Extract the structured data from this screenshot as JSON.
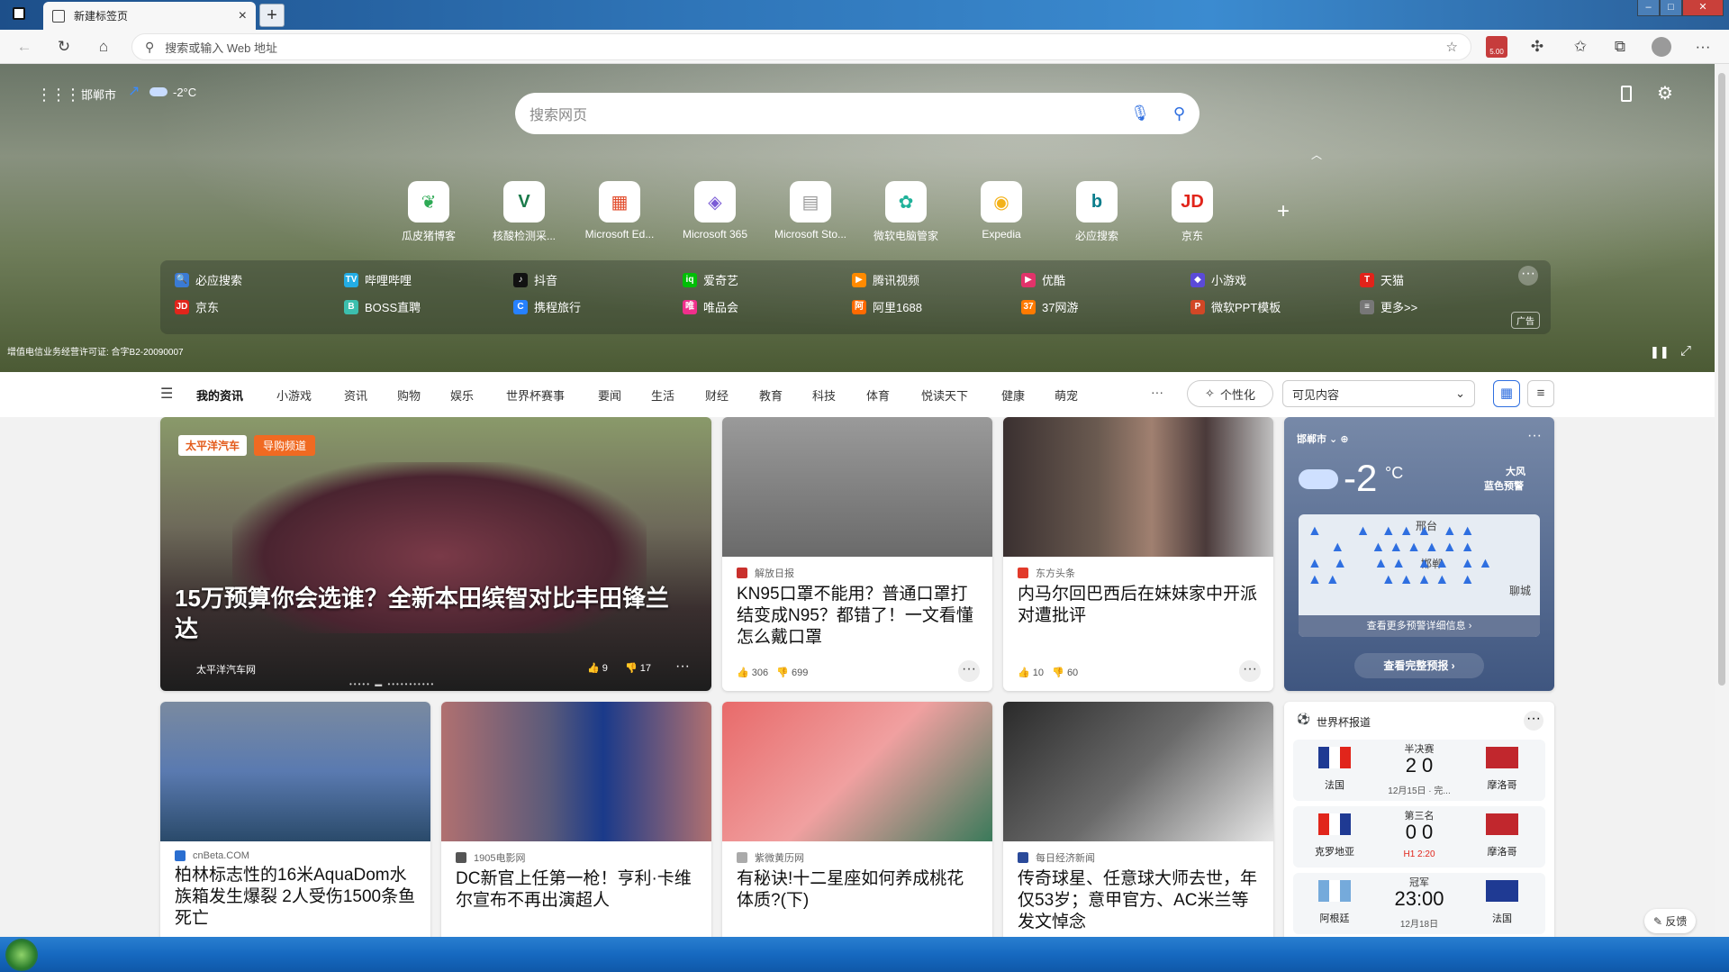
{
  "browser": {
    "tab_title": "新建标签页",
    "tab_close": "×",
    "new_tab": "+",
    "address_placeholder": "搜索或输入 Web 地址",
    "badge": "5.00",
    "win_min": "–",
    "win_max": "□",
    "win_close": "✕"
  },
  "header": {
    "city": "邯郸市",
    "temp": "-2°C",
    "search_placeholder": "搜索网页",
    "license": "增值电信业务经营许可证: 合字B2-20090007"
  },
  "quick_links": [
    {
      "label": "瓜皮猪博客",
      "glyph": "❦",
      "color": "#2eaa55"
    },
    {
      "label": "核酸检测采...",
      "glyph": "V",
      "color": "#1a7a4a"
    },
    {
      "label": "Microsoft Ed...",
      "glyph": "▦",
      "color": "#e24c2c"
    },
    {
      "label": "Microsoft 365",
      "glyph": "◈",
      "color": "#7b5cd6"
    },
    {
      "label": "Microsoft Sto...",
      "glyph": "▤",
      "color": "#999999"
    },
    {
      "label": "微软电脑管家",
      "glyph": "✿",
      "color": "#1fb29a"
    },
    {
      "label": "Expedia",
      "glyph": "◉",
      "color": "#f3b21a"
    },
    {
      "label": "必应搜索",
      "glyph": "b",
      "color": "#0a7d8c"
    },
    {
      "label": "京东",
      "glyph": "JD",
      "color": "#e1251b"
    }
  ],
  "site_links": [
    {
      "label": "必应搜索",
      "glyph": "🔍",
      "color": "#3a7bd5"
    },
    {
      "label": "哔哩哔哩",
      "glyph": "TV",
      "color": "#23ade5"
    },
    {
      "label": "抖音",
      "glyph": "♪",
      "color": "#111111"
    },
    {
      "label": "爱奇艺",
      "glyph": "iq",
      "color": "#00be06"
    },
    {
      "label": "腾讯视频",
      "glyph": "▶",
      "color": "#ff8a00"
    },
    {
      "label": "优酷",
      "glyph": "▶",
      "color": "#e2336a"
    },
    {
      "label": "小游戏",
      "glyph": "◆",
      "color": "#5b4ad8"
    },
    {
      "label": "天猫",
      "glyph": "T",
      "color": "#e2231a"
    },
    {
      "label": "京东",
      "glyph": "JD",
      "color": "#e1251b"
    },
    {
      "label": "BOSS直聘",
      "glyph": "B",
      "color": "#3cbfae"
    },
    {
      "label": "携程旅行",
      "glyph": "C",
      "color": "#2681ff"
    },
    {
      "label": "唯品会",
      "glyph": "唯",
      "color": "#f02f8c"
    },
    {
      "label": "阿里1688",
      "glyph": "阿",
      "color": "#ff6a00"
    },
    {
      "label": "37网游",
      "glyph": "37",
      "color": "#ff7a00"
    },
    {
      "label": "微软PPT模板",
      "glyph": "P",
      "color": "#d24726"
    },
    {
      "label": "更多>>",
      "glyph": "≡",
      "color": "#777777"
    }
  ],
  "ad_label": "广告",
  "nav": {
    "items": [
      "我的资讯",
      "小游戏",
      "资讯",
      "购物",
      "娱乐",
      "世界杯赛事",
      "要闻",
      "生活",
      "财经",
      "教育",
      "科技",
      "体育",
      "悦读天下",
      "健康",
      "萌宠"
    ],
    "more": "···",
    "personalize": "个性化",
    "visible_content": "可见内容"
  },
  "cards": [
    {
      "source": "太平洋汽车网",
      "title": "15万预算你会选谁？全新本田缤智对比丰田锋兰达",
      "likes": "9",
      "dislikes": "17",
      "tag1": "太平洋汽车",
      "tag2": "导购频道"
    },
    {
      "source": "解放日报",
      "title": "KN95口罩不能用？普通口罩打结变成N95？都错了！一文看懂怎么戴口罩",
      "likes": "306",
      "dislikes": "699"
    },
    {
      "source": "东方头条",
      "title": "内马尔回巴西后在妹妹家中开派对遭批评",
      "likes": "10",
      "dislikes": "60"
    },
    {
      "source": "cnBeta.COM",
      "title": "柏林标志性的16米AquaDom水族箱发生爆裂 2人受伤1500条鱼死亡"
    },
    {
      "source": "1905电影网",
      "title": "DC新官上任第一枪！亨利·卡维尔宣布不再出演超人"
    },
    {
      "source": "紫微黄历网",
      "title": "有秘诀!十二星座如何养成桃花体质?(下)"
    },
    {
      "source": "每日经济新闻",
      "title": "传奇球星、任意球大师去世，年仅53岁；意甲官方、AC米兰等发文悼念"
    }
  ],
  "weather": {
    "city": "邯郸市",
    "temp": "-2",
    "unit": "°C",
    "alert": "大风",
    "alert_level": "蓝色预警",
    "map_city1": "邢台",
    "map_city2": "邯郸",
    "map_city3": "聊城",
    "map_link": "查看更多预警详细信息 ›",
    "forecast_btn": "查看完整预报 ›"
  },
  "worldcup": {
    "title": "世界杯报道",
    "matches": [
      {
        "stage": "半决赛",
        "home": "法国",
        "away": "摩洛哥",
        "score": "2 0",
        "time": "12月15日 · 完...",
        "home_flag": [
          "#1f3a93",
          "#ffffff",
          "#e1251b"
        ],
        "away_flag": "#c1272d"
      },
      {
        "stage": "第三名",
        "home": "克罗地亚",
        "away": "摩洛哥",
        "score": "0 0",
        "time": "H1 2:20",
        "home_flag": [
          "#e1251b",
          "#ffffff",
          "#1f3a93"
        ],
        "away_flag": "#c1272d"
      },
      {
        "stage": "冠军",
        "home": "阿根廷",
        "away": "法国",
        "score": "23:00",
        "time": "12月18日",
        "home_flag": [
          "#75aadb",
          "#ffffff",
          "#75aadb"
        ],
        "away_flag": "#1f3a93"
      }
    ]
  },
  "feedback": "反馈"
}
